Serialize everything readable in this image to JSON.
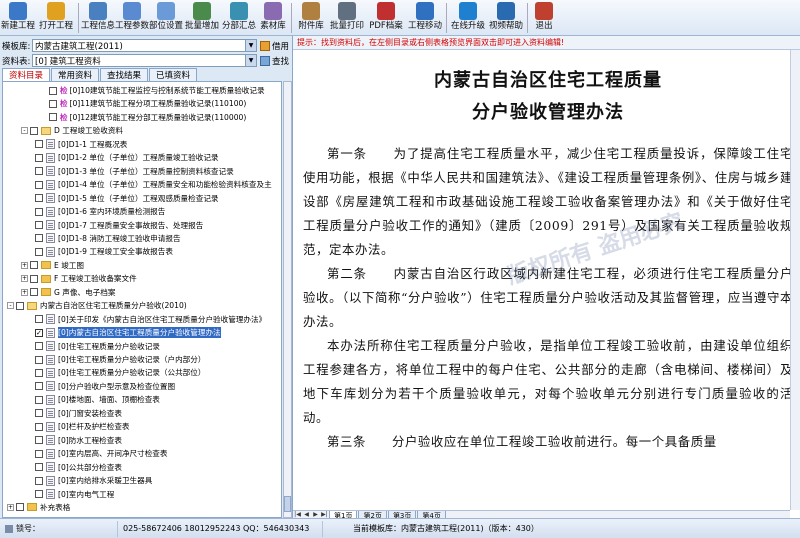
{
  "toolbar": {
    "buttons": [
      {
        "label": "新建工程",
        "icon": "new-project-icon",
        "color": "#3c78c8"
      },
      {
        "label": "打开工程",
        "icon": "open-project-icon",
        "color": "#e0a020"
      },
      {
        "label": "工程信息",
        "icon": "project-info-icon",
        "color": "#4a7fc0"
      },
      {
        "label": "工程参数",
        "icon": "project-params-icon",
        "color": "#5a8ad0"
      },
      {
        "label": "部位设置",
        "icon": "location-settings-icon",
        "color": "#6a9ad8"
      },
      {
        "label": "批量增加",
        "icon": "batch-add-icon",
        "color": "#4a8a4a"
      },
      {
        "label": "分部汇总",
        "icon": "summary-icon",
        "color": "#3a90b0"
      },
      {
        "label": "素材库",
        "icon": "material-library-icon",
        "color": "#8a6ab0"
      },
      {
        "label": "附件库",
        "icon": "attachment-library-icon",
        "color": "#b08040"
      },
      {
        "label": "批量打印",
        "icon": "batch-print-icon",
        "color": "#607080"
      },
      {
        "label": "PDF档案",
        "icon": "pdf-icon",
        "color": "#c03030"
      },
      {
        "label": "工程移动",
        "icon": "move-project-icon",
        "color": "#3070c0"
      },
      {
        "label": "在线升级",
        "icon": "online-upgrade-icon",
        "color": "#2080d0"
      },
      {
        "label": "视频帮助",
        "icon": "video-help-icon",
        "color": "#2a6ab0"
      },
      {
        "label": "退出",
        "icon": "exit-icon",
        "color": "#c04030"
      }
    ]
  },
  "left": {
    "template_label": "模板库:",
    "template_value": "内蒙古建筑工程(2011)",
    "borrow_label": "借用",
    "library_label": "资料表:",
    "library_value": "[0] 建筑工程资料",
    "search_label": "查找",
    "tabs": [
      "资料目录",
      "常用资料",
      "查找结果",
      "已填资料"
    ],
    "tree": [
      {
        "indent": 3,
        "kind": "check",
        "text": "[0]10建筑节能工程监控与控制系统节能工程质量验收记录",
        "checked": false
      },
      {
        "indent": 3,
        "kind": "check",
        "text": "[0]11建筑节能工程分项工程质量验收记录(110100)",
        "checked": false
      },
      {
        "indent": 3,
        "kind": "check",
        "text": "[0]12建筑节能工程分部工程质量验收记录(110000)",
        "checked": false
      },
      {
        "indent": 1,
        "kind": "folder-open",
        "pm": "-",
        "text": "D 工程竣工验收资料"
      },
      {
        "indent": 2,
        "kind": "doc",
        "text": "[0]D1-1 工程概况表"
      },
      {
        "indent": 2,
        "kind": "doc",
        "text": "[0]D1-2 单位（子单位）工程质量竣工验收记录"
      },
      {
        "indent": 2,
        "kind": "doc",
        "text": "[0]D1-3 单位（子单位）工程质量控制资料核查记录"
      },
      {
        "indent": 2,
        "kind": "doc",
        "text": "[0]D1-4 单位（子单位）工程质量安全和功能检验资料核查及主"
      },
      {
        "indent": 2,
        "kind": "doc",
        "text": "[0]D1-5 单位（子单位）工程观感质量检查记录"
      },
      {
        "indent": 2,
        "kind": "doc",
        "text": "[0]D1-6 室内环境质量检测报告"
      },
      {
        "indent": 2,
        "kind": "doc",
        "text": "[0]D1-7 工程质量安全事故报告、处理报告"
      },
      {
        "indent": 2,
        "kind": "doc",
        "text": "[0]D1-8 消防工程竣工验收申请报告"
      },
      {
        "indent": 2,
        "kind": "doc",
        "text": "[0]D1-9 工程竣工安全事故报告表"
      },
      {
        "indent": 1,
        "kind": "folder",
        "pm": "+",
        "text": "E 竣工图"
      },
      {
        "indent": 1,
        "kind": "folder",
        "pm": "+",
        "text": "F 工程竣工验收备案文件"
      },
      {
        "indent": 1,
        "kind": "folder",
        "pm": "+",
        "text": "G 声像、电子档案"
      },
      {
        "indent": 0,
        "kind": "folder-open",
        "pm": "-",
        "text": "内蒙古自治区住宅工程质量分户验收(2010)"
      },
      {
        "indent": 2,
        "kind": "doc",
        "text": "[0]关于印发《内蒙古自治区住宅工程质量分户验收管理办法》"
      },
      {
        "indent": 2,
        "kind": "doc-sel",
        "text": "[0]内蒙古自治区住宅工程质量分户验收管理办法",
        "selected": true
      },
      {
        "indent": 2,
        "kind": "doc",
        "text": "[0]住宅工程质量分户验收记录"
      },
      {
        "indent": 2,
        "kind": "doc",
        "text": "[0]住宅工程质量分户验收记录（户内部分）"
      },
      {
        "indent": 2,
        "kind": "doc",
        "text": "[0]住宅工程质量分户验收记录（公共部位）"
      },
      {
        "indent": 2,
        "kind": "doc",
        "text": "[0]分户验收户型示意及检查位置图"
      },
      {
        "indent": 2,
        "kind": "doc",
        "text": "[0]楼地面、墙面、顶棚检查表"
      },
      {
        "indent": 2,
        "kind": "doc",
        "text": "[0]门窗安装检查表"
      },
      {
        "indent": 2,
        "kind": "doc",
        "text": "[0]栏杆及护栏检查表"
      },
      {
        "indent": 2,
        "kind": "doc",
        "text": "[0]防水工程检查表"
      },
      {
        "indent": 2,
        "kind": "doc",
        "text": "[0]室内层高、开间净尺寸检查表"
      },
      {
        "indent": 2,
        "kind": "doc",
        "text": "[0]公共部分检查表"
      },
      {
        "indent": 2,
        "kind": "doc",
        "text": "[0]室内给排水采暖卫生器具"
      },
      {
        "indent": 2,
        "kind": "doc",
        "text": "[0]室内电气工程"
      },
      {
        "indent": 0,
        "kind": "folder",
        "pm": "+",
        "text": "补充表格"
      }
    ]
  },
  "right": {
    "hint": "提示：找到资料后，在左侧目录或右侧表格预览界面双击即可进入资料编辑!",
    "title1": "内蒙古自治区住宅工程质量",
    "title2": "分户验收管理办法",
    "paragraphs": [
      "第一条　　为了提高住宅工程质量水平，减少住宅工程质量投诉，保障竣工住宅使用功能，根据《中华人民共和国建筑法》、《建设工程质量管理条例》、住房与城乡建设部《房屋建筑工程和市政基础设施工程竣工验收备案管理办法》和《关于做好住宅工程质量分户验收工作的通知》（建质〔2009〕291号）及国家有关工程质量验收规范，定本办法。",
      "第二条　　内蒙古自治区行政区域内新建住宅工程，必须进行住宅工程质量分户验收。（以下简称“分户验收”）住宅工程质量分户验收活动及其监督管理，应当遵守本办法。",
      "本办法所称住宅工程质量分户验收，是指单位工程竣工验收前，由建设单位组织工程参建各方，将单位工程中的每户住宅、公共部分的走廊（含电梯间、楼梯间）及地下车库划分为若干个质量验收单元，对每个验收单元分别进行专门质量验收的活动。",
      "第三条　　分户验收应在单位工程竣工验收前进行。每一个具备质量"
    ],
    "page_tabs": [
      "第1页",
      "第2页",
      "第3页",
      "第4页"
    ],
    "watermark": "版权所有 盗用必究"
  },
  "status": {
    "lock_label": "锁号：",
    "phones": "025-58672406 18012952243 QQ：546430343",
    "current_template": "当前模板库：内蒙古建筑工程(2011)（版本：430）"
  }
}
